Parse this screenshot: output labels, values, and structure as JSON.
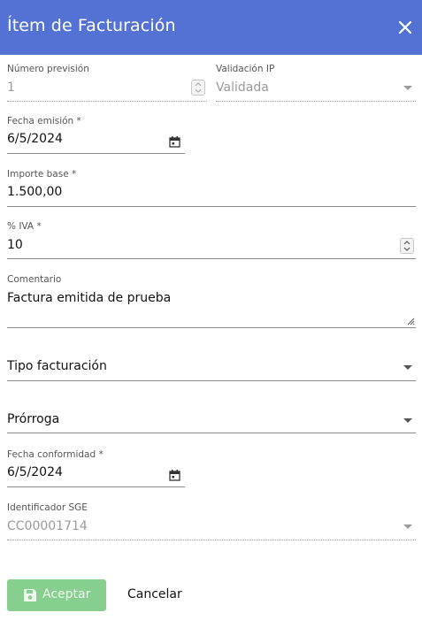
{
  "dialog": {
    "title": "Ítem de Facturación",
    "close_icon": "close-icon"
  },
  "fields": {
    "numero_prevision": {
      "label": "Número previsión",
      "value": "1"
    },
    "validacion_ip": {
      "label": "Validación IP",
      "value": "Validada"
    },
    "fecha_emision": {
      "label": "Fecha emisión *",
      "value": "6/5/2024"
    },
    "importe_base": {
      "label": "Importe base *",
      "value": "1.500,00"
    },
    "iva": {
      "label": "% IVA *",
      "value": "10"
    },
    "comentario": {
      "label": "Comentario",
      "value": "Factura emitida de prueba"
    },
    "tipo_facturacion": {
      "placeholder": "Tipo facturación"
    },
    "prorroga": {
      "placeholder": "Prórroga"
    },
    "fecha_conformidad": {
      "label": "Fecha conformidad *",
      "value": "6/5/2024"
    },
    "identificador_sge": {
      "label": "Identificador SGE",
      "value": "CC00001714"
    }
  },
  "actions": {
    "accept_label": "Aceptar",
    "cancel_label": "Cancelar"
  },
  "colors": {
    "header": "#5472d3",
    "accept_disabled": "#86cf8f"
  }
}
